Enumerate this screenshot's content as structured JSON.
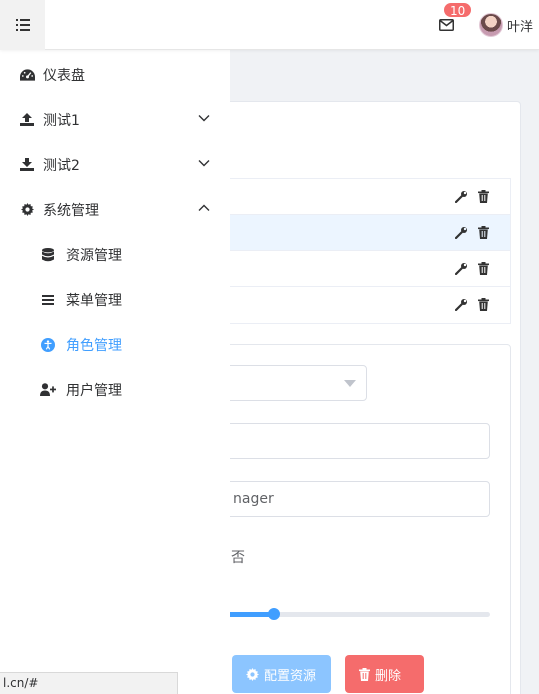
{
  "header": {
    "notification_count": "10",
    "username": "叶洋"
  },
  "sidebar": {
    "items": [
      {
        "label": "仪表盘",
        "icon": "dashboard-icon"
      },
      {
        "label": "测试1",
        "icon": "upload-icon"
      },
      {
        "label": "测试2",
        "icon": "download-icon"
      },
      {
        "label": "系统管理",
        "icon": "gear-icon"
      }
    ],
    "subitems": [
      {
        "label": "资源管理",
        "icon": "database-icon"
      },
      {
        "label": "菜单管理",
        "icon": "list-icon"
      },
      {
        "label": "角色管理",
        "icon": "accessibility-icon"
      },
      {
        "label": "用户管理",
        "icon": "user-plus-icon"
      }
    ]
  },
  "form": {
    "name_value": "nager",
    "radio_label": "否",
    "slider_value": 0.18,
    "config_button": "配置资源",
    "delete_button": "删除"
  },
  "statusbar": {
    "url": "l.cn/#"
  },
  "colors": {
    "accent": "#409eff",
    "danger": "#f56c6c",
    "badge": "#f56c6c"
  }
}
